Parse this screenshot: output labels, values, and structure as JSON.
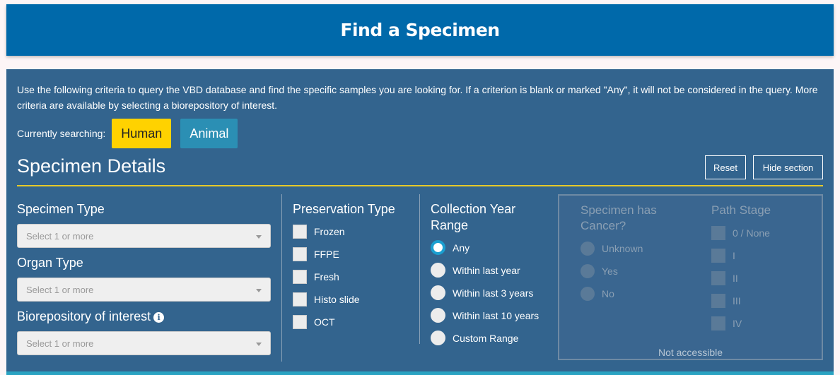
{
  "header": {
    "title": "Find a Specimen"
  },
  "intro": "Use the following criteria to query the VBD database and find the specific samples you are looking for. If a criterion is blank or marked \"Any\", it will not be considered in the query. More criteria are available by selecting a biorepository of interest.",
  "searching": {
    "label": "Currently searching:",
    "options": [
      "Human",
      "Animal"
    ],
    "active": "Human"
  },
  "section": {
    "title": "Specimen Details",
    "reset_label": "Reset",
    "hide_label": "Hide section"
  },
  "specimen_type": {
    "label": "Specimen Type",
    "placeholder": "Select 1 or more"
  },
  "organ_type": {
    "label": "Organ Type",
    "placeholder": "Select 1 or more"
  },
  "biorepository": {
    "label": "Biorepository of interest",
    "placeholder": "Select 1 or more"
  },
  "preservation": {
    "label": "Preservation Type",
    "options": [
      "Frozen",
      "FFPE",
      "Fresh",
      "Histo slide",
      "OCT"
    ]
  },
  "collection": {
    "label_line1": "Collection Year",
    "label_line2": "Range",
    "options": [
      "Any",
      "Within last year",
      "Within last 3 years",
      "Within last 10 years",
      "Custom Range"
    ],
    "selected": "Any"
  },
  "cancer": {
    "label_line1": "Specimen has",
    "label_line2": "Cancer?",
    "options": [
      "Unknown",
      "Yes",
      "No"
    ]
  },
  "path_stage": {
    "label": "Path Stage",
    "options": [
      "0 / None",
      "I",
      "II",
      "III",
      "IV"
    ]
  },
  "not_accessible": "Not accessible",
  "colors": {
    "header": "#0069aa",
    "panel": "#33648e",
    "accent_yellow": "#ffd200",
    "radio_selected": "#1a9fd0"
  }
}
